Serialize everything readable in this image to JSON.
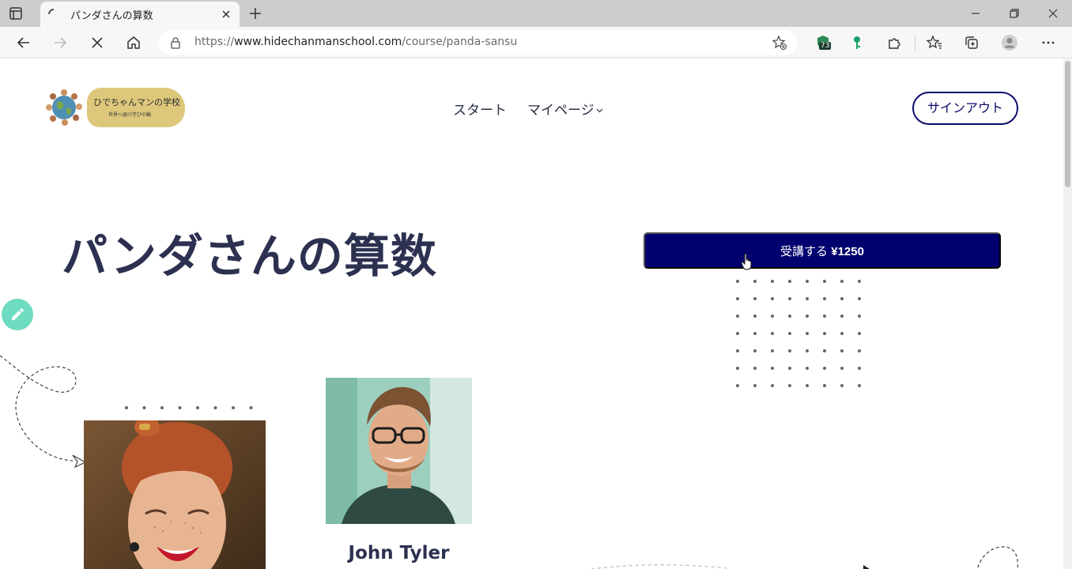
{
  "browser": {
    "tab_title": "パンダさんの算数",
    "url_prefix": "https://",
    "url_host": "www.hidechanmanschool.com",
    "url_path": "/course/panda-sansu",
    "extension_badge": "73"
  },
  "site": {
    "logo_title": "ひでちゃんマンの学校",
    "logo_subtitle": "世界へ届け学びの輪",
    "nav": {
      "start": "スタート",
      "mypage": "マイページ"
    },
    "signout_label": "サインアウト"
  },
  "course": {
    "title": "パンダさんの算数",
    "enroll_label": "受講する",
    "price": "¥1250"
  },
  "teachers": [
    {
      "name": ""
    },
    {
      "name": "John Tyler"
    }
  ],
  "colors": {
    "primary": "#00006e",
    "heading": "#2c3150",
    "logo_badge": "#dcc77b",
    "edit_fab": "#6edcc0"
  }
}
